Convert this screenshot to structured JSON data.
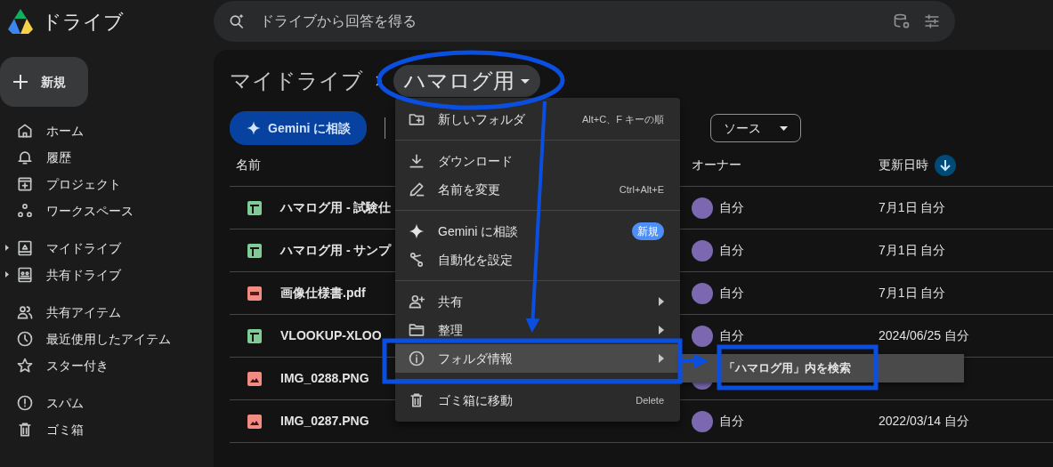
{
  "app": {
    "title": "ドライブ"
  },
  "search": {
    "placeholder": "ドライブから回答を得る"
  },
  "new_button": {
    "label": "新規"
  },
  "sidebar": {
    "groups": [
      [
        {
          "label": "ホーム",
          "expandable": false
        },
        {
          "label": "履歴",
          "expandable": false
        },
        {
          "label": "プロジェクト",
          "expandable": false
        },
        {
          "label": "ワークスペース",
          "expandable": false
        }
      ],
      [
        {
          "label": "マイドライブ",
          "expandable": true
        },
        {
          "label": "共有ドライブ",
          "expandable": true
        }
      ],
      [
        {
          "label": "共有アイテム",
          "expandable": false
        },
        {
          "label": "最近使用したアイテム",
          "expandable": false
        },
        {
          "label": "スター付き",
          "expandable": false
        }
      ],
      [
        {
          "label": "スパム",
          "expandable": false
        },
        {
          "label": "ゴミ箱",
          "expandable": false
        }
      ]
    ]
  },
  "breadcrumb": [
    {
      "label": "マイドライブ",
      "current": false
    },
    {
      "label": "ハマログ用",
      "current": true
    }
  ],
  "toolbar": {
    "gemini_button": "Gemini に相談",
    "filters": [
      {
        "label": "ソース"
      }
    ]
  },
  "table": {
    "columns": [
      {
        "label": "名前",
        "sorted": false
      },
      {
        "label": "オーナー",
        "sorted": false
      },
      {
        "label": "更新日時",
        "sorted": true
      }
    ],
    "rows": [
      {
        "name": "ハマログ用 - 試験仕",
        "kind": "sheet",
        "owner": "自分",
        "modified": "7月1日 自分"
      },
      {
        "name": "ハマログ用 - サンプ",
        "kind": "sheet",
        "owner": "自分",
        "modified": "7月1日 自分"
      },
      {
        "name": "画像仕様書.pdf",
        "kind": "pdf",
        "owner": "自分",
        "modified": "7月1日 自分"
      },
      {
        "name": "VLOOKUP-XLOO",
        "kind": "sheet",
        "owner": "自分",
        "modified": "2024/06/25 自分"
      },
      {
        "name": "IMG_0288.PNG",
        "kind": "image"
      },
      {
        "name": "IMG_0287.PNG",
        "kind": "image",
        "owner": "自分",
        "modified": "2022/03/14 自分"
      }
    ]
  },
  "context_menu": {
    "groups": [
      [
        {
          "label": "新しいフォルダ",
          "shortcut": "Alt+C、F キーの順",
          "has_submenu": false,
          "selected": false
        }
      ],
      [
        {
          "label": "ダウンロード",
          "has_submenu": false,
          "selected": false
        },
        {
          "label": "名前を変更",
          "shortcut": "Ctrl+Alt+E",
          "has_submenu": false,
          "selected": false
        }
      ],
      [
        {
          "label": "Gemini に相談",
          "badge": "新規",
          "has_submenu": false,
          "selected": false
        },
        {
          "label": "自動化を設定",
          "has_submenu": false,
          "selected": false
        }
      ],
      [
        {
          "label": "共有",
          "has_submenu": true,
          "selected": false
        },
        {
          "label": "整理",
          "has_submenu": true,
          "selected": false
        },
        {
          "label": "フォルダ情報",
          "has_submenu": true,
          "selected": true
        }
      ],
      [
        {
          "label": "ゴミ箱に移動",
          "shortcut": "Delete",
          "has_submenu": false,
          "selected": false
        }
      ]
    ],
    "submenu": {
      "items": [
        {
          "label": "「ハマログ用」内を検索",
          "selected": true
        }
      ]
    }
  }
}
